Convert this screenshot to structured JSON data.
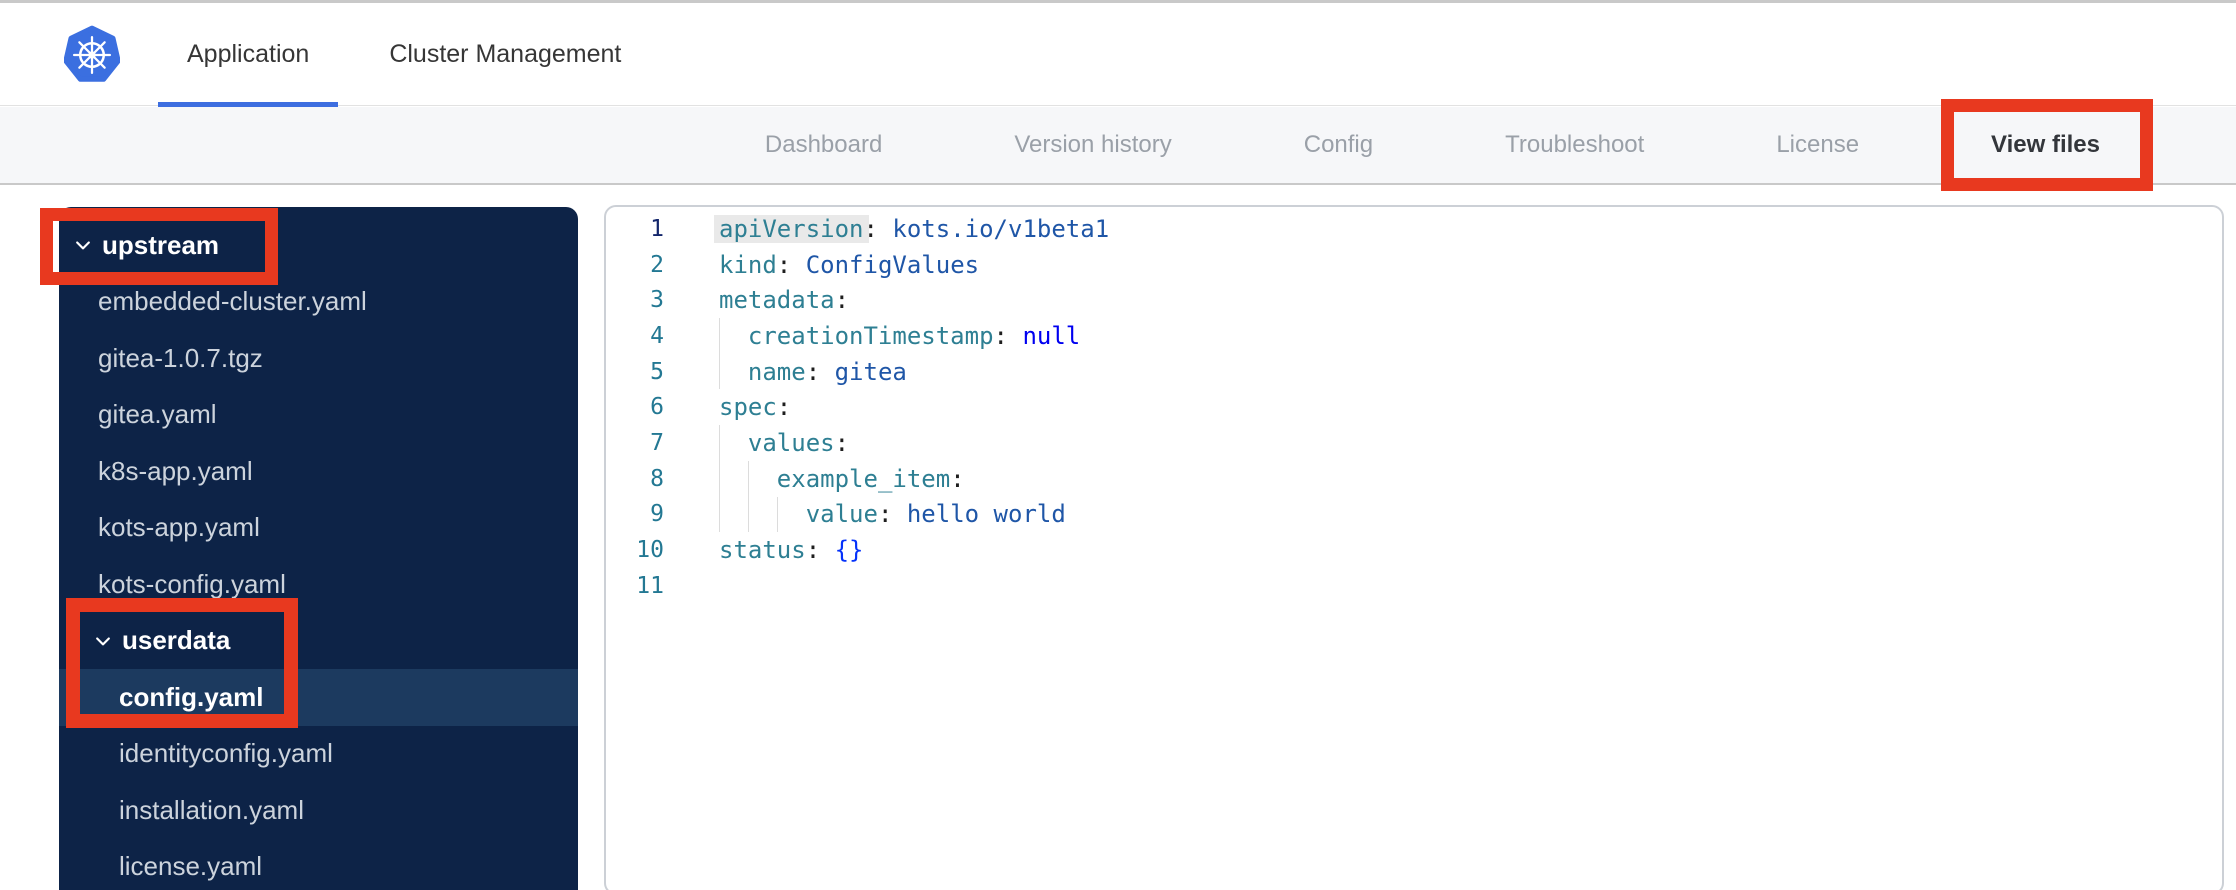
{
  "header": {
    "tabs": [
      {
        "label": "Application",
        "active": true
      },
      {
        "label": "Cluster Management",
        "active": false
      }
    ]
  },
  "nav": {
    "items": [
      {
        "label": "Dashboard",
        "active": false
      },
      {
        "label": "Version history",
        "active": false
      },
      {
        "label": "Config",
        "active": false
      },
      {
        "label": "Troubleshoot",
        "active": false
      },
      {
        "label": "License",
        "active": false
      },
      {
        "label": "View files",
        "active": true
      }
    ]
  },
  "file_tree": {
    "items": [
      {
        "label": "upstream",
        "type": "folder",
        "indent": 0,
        "expanded": true
      },
      {
        "label": "embedded-cluster.yaml",
        "type": "file",
        "indent": 1
      },
      {
        "label": "gitea-1.0.7.tgz",
        "type": "file",
        "indent": 1
      },
      {
        "label": "gitea.yaml",
        "type": "file",
        "indent": 1
      },
      {
        "label": "k8s-app.yaml",
        "type": "file",
        "indent": 1
      },
      {
        "label": "kots-app.yaml",
        "type": "file",
        "indent": 1
      },
      {
        "label": "kots-config.yaml",
        "type": "file",
        "indent": 1
      },
      {
        "label": "userdata",
        "type": "folder",
        "indent": 1,
        "expanded": true
      },
      {
        "label": "config.yaml",
        "type": "file",
        "indent": 2,
        "selected": true
      },
      {
        "label": "identityconfig.yaml",
        "type": "file",
        "indent": 2
      },
      {
        "label": "installation.yaml",
        "type": "file",
        "indent": 2
      },
      {
        "label": "license.yaml",
        "type": "file",
        "indent": 2
      }
    ]
  },
  "editor": {
    "language": "yaml",
    "lines": [
      {
        "num": 1,
        "indent": 0,
        "active": true,
        "tokens": [
          [
            "k hl",
            "apiVersion"
          ],
          [
            "p",
            ":"
          ],
          [
            "p",
            " "
          ],
          [
            "s",
            "kots.io/v1beta1"
          ]
        ]
      },
      {
        "num": 2,
        "indent": 0,
        "tokens": [
          [
            "k",
            "kind"
          ],
          [
            "p",
            ":"
          ],
          [
            "p",
            " "
          ],
          [
            "s",
            "ConfigValues"
          ]
        ]
      },
      {
        "num": 3,
        "indent": 0,
        "tokens": [
          [
            "k",
            "metadata"
          ],
          [
            "p",
            ":"
          ]
        ]
      },
      {
        "num": 4,
        "indent": 1,
        "tokens": [
          [
            "k",
            "creationTimestamp"
          ],
          [
            "p",
            ":"
          ],
          [
            "p",
            " "
          ],
          [
            "kw",
            "null"
          ]
        ]
      },
      {
        "num": 5,
        "indent": 1,
        "tokens": [
          [
            "k",
            "name"
          ],
          [
            "p",
            ":"
          ],
          [
            "p",
            " "
          ],
          [
            "s",
            "gitea"
          ]
        ]
      },
      {
        "num": 6,
        "indent": 0,
        "tokens": [
          [
            "k",
            "spec"
          ],
          [
            "p",
            ":"
          ]
        ]
      },
      {
        "num": 7,
        "indent": 1,
        "tokens": [
          [
            "k",
            "values"
          ],
          [
            "p",
            ":"
          ]
        ]
      },
      {
        "num": 8,
        "indent": 2,
        "tokens": [
          [
            "k",
            "example_item"
          ],
          [
            "p",
            ":"
          ]
        ]
      },
      {
        "num": 9,
        "indent": 3,
        "tokens": [
          [
            "k",
            "value"
          ],
          [
            "p",
            ":"
          ],
          [
            "p",
            " "
          ],
          [
            "s",
            "hello world"
          ]
        ]
      },
      {
        "num": 10,
        "indent": 0,
        "tokens": [
          [
            "k",
            "status"
          ],
          [
            "p",
            ":"
          ],
          [
            "p",
            " "
          ],
          [
            "b",
            "{}"
          ]
        ]
      },
      {
        "num": 11,
        "indent": 0,
        "tokens": []
      }
    ]
  },
  "annotations": {
    "color": "#e8391f",
    "targets": [
      "View files",
      "upstream",
      "userdata / config.yaml"
    ]
  },
  "colors": {
    "accent_blue": "#3d6ee0",
    "logo_blue": "#3b6fe0",
    "annotation_red": "#e8391f",
    "sidebar_bg": "#0d2347",
    "sidebar_selected_bg": "#1c3a5f",
    "nav_bg": "#f6f7f9",
    "code_key_teal": "#2e7f93",
    "code_string_blue": "#1f56a7",
    "code_keyword_blue": "#0000f0",
    "code_bracket_blue": "#0431fa",
    "line_number_teal": "#237893"
  }
}
